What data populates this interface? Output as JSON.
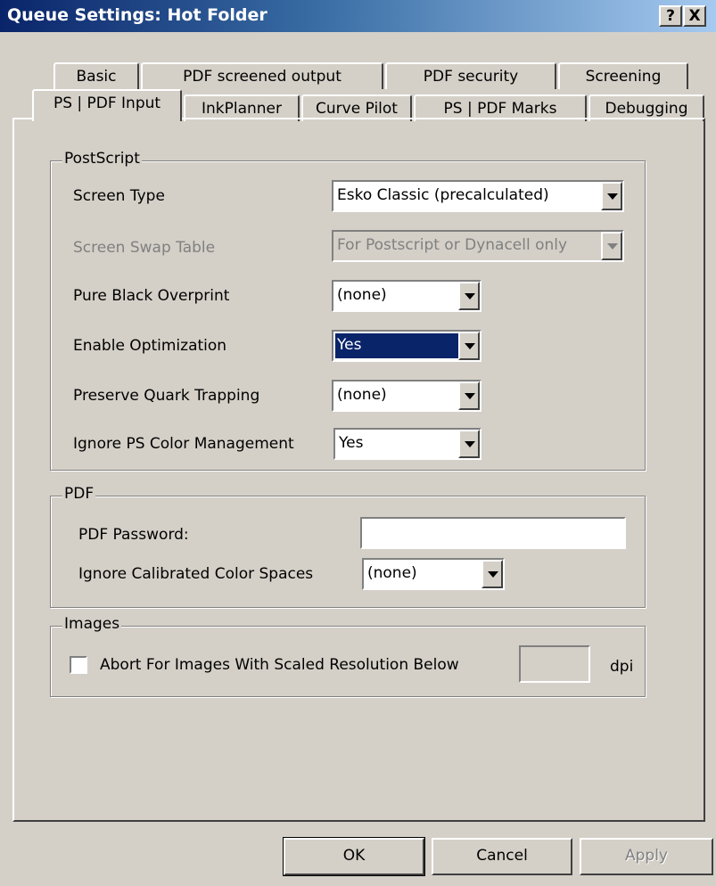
{
  "window": {
    "title": "Queue Settings: Hot Folder",
    "help_button": "?",
    "close_button": "X"
  },
  "tabs": {
    "row1": [
      "Basic",
      "PDF screened output",
      "PDF security",
      "Screening"
    ],
    "row2": [
      "PS | PDF Input",
      "InkPlanner",
      "Curve Pilot",
      "PS | PDF Marks",
      "Debugging"
    ],
    "active": "PS | PDF Input"
  },
  "postscript": {
    "legend": "PostScript",
    "screen_type": {
      "label": "Screen Type",
      "value": "Esko Classic (precalculated)"
    },
    "screen_swap_table": {
      "label": "Screen Swap Table",
      "value": "For Postscript or Dynacell only"
    },
    "pure_black_overprint": {
      "label": "Pure Black Overprint",
      "value": "(none)"
    },
    "enable_optimization": {
      "label": "Enable Optimization",
      "value": "Yes"
    },
    "preserve_quark_trapping": {
      "label": "Preserve Quark Trapping",
      "value": "(none)"
    },
    "ignore_ps_color_management": {
      "label": "Ignore PS Color Management",
      "value": "Yes"
    }
  },
  "pdf": {
    "legend": "PDF",
    "password": {
      "label": "PDF Password:",
      "value": ""
    },
    "ignore_calibrated": {
      "label": "Ignore Calibrated Color Spaces",
      "value": "(none)"
    }
  },
  "images": {
    "legend": "Images",
    "abort_label": "Abort For Images With Scaled Resolution Below",
    "abort_checked": false,
    "resolution_value": "",
    "unit": "dpi"
  },
  "buttons": {
    "ok": "OK",
    "cancel": "Cancel",
    "apply": "Apply"
  },
  "colors": {
    "titlebar_start": "#0a246a",
    "titlebar_end": "#a6caf0",
    "face": "#d4d0c8",
    "selection": "#0a246a"
  }
}
